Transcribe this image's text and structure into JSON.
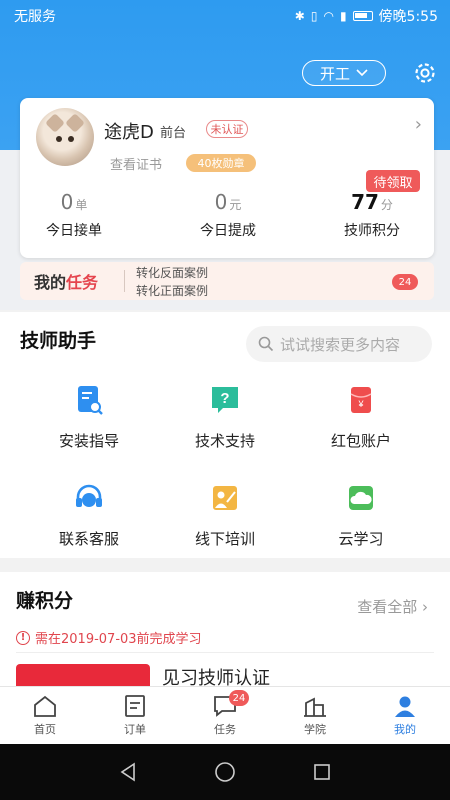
{
  "status_bar": {
    "carrier": "无服务",
    "time": "傍晚5:55"
  },
  "header": {
    "work_status_label": "开工"
  },
  "profile": {
    "name": "途虎D",
    "role": "前台",
    "verify_badge": "未认证",
    "view_certificate": "查看证书",
    "medal_badge": "40枚勋章",
    "pending_badge": "待领取",
    "stats": [
      {
        "value": "0",
        "unit": "单",
        "label": "今日接单"
      },
      {
        "value": "0",
        "unit": "元",
        "label": "今日提成"
      },
      {
        "value": "77",
        "unit": "分",
        "label": "技师积分"
      }
    ]
  },
  "my_tasks": {
    "title_prefix": "我的",
    "title_accent": "任务",
    "line1": "转化反面案例",
    "line2": "转化正面案例",
    "count": "24"
  },
  "assistant": {
    "title": "技师助手",
    "search_placeholder": "试试搜索更多内容",
    "tools": [
      {
        "label": "安装指导",
        "icon": "install-guide-icon",
        "color": "#2e8ff0"
      },
      {
        "label": "技术支持",
        "icon": "tech-support-icon",
        "color": "#2bbd9b"
      },
      {
        "label": "红包账户",
        "icon": "red-packet-icon",
        "color": "#ef4d4d"
      },
      {
        "label": "联系客服",
        "icon": "customer-service-icon",
        "color": "#2e8ff0"
      },
      {
        "label": "线下培训",
        "icon": "offline-training-icon",
        "color": "#f3b643"
      },
      {
        "label": "云学习",
        "icon": "cloud-learning-icon",
        "color": "#4cbd5a"
      }
    ]
  },
  "earn_points": {
    "title": "赚积分",
    "see_all": "查看全部",
    "deadline": "需在2019-07-03前完成学习",
    "course_name": "见习技师认证"
  },
  "tabbar": {
    "tabs": [
      {
        "label": "首页",
        "icon": "home-icon"
      },
      {
        "label": "订单",
        "icon": "order-icon"
      },
      {
        "label": "任务",
        "icon": "task-icon",
        "badge": "24"
      },
      {
        "label": "学院",
        "icon": "academy-icon"
      },
      {
        "label": "我的",
        "icon": "profile-icon",
        "active": true
      }
    ]
  },
  "colors": {
    "primary": "#2e9bf0",
    "accent_red": "#ef5a5a",
    "active_tab": "#2e7fe0"
  }
}
